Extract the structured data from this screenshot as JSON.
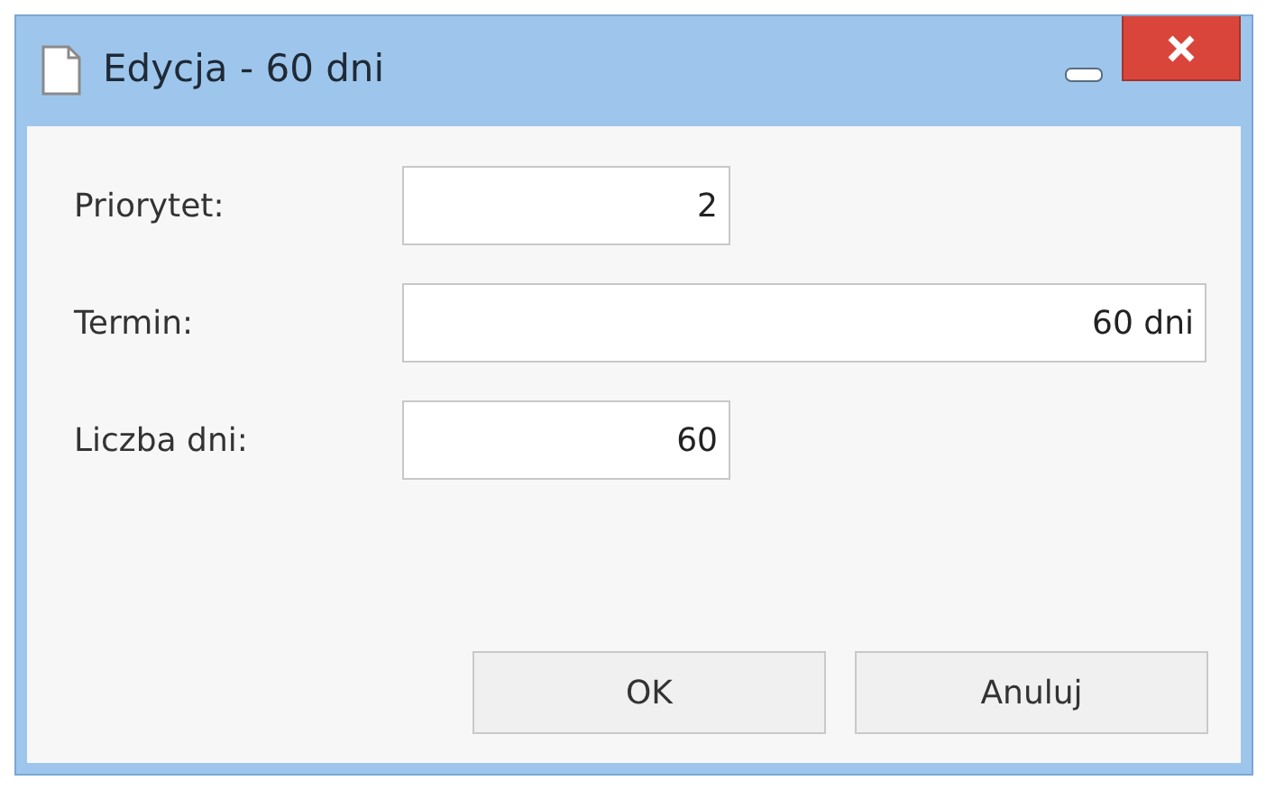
{
  "window": {
    "title": "Edycja - 60 dni"
  },
  "fields": [
    {
      "label": "Priorytet:",
      "value": "2",
      "kind": "number"
    },
    {
      "label": "Termin:",
      "value": "60 dni",
      "kind": "text"
    },
    {
      "label": "Liczba dni:",
      "value": "60",
      "kind": "number"
    }
  ],
  "buttons": [
    "OK",
    "Anuluj"
  ]
}
